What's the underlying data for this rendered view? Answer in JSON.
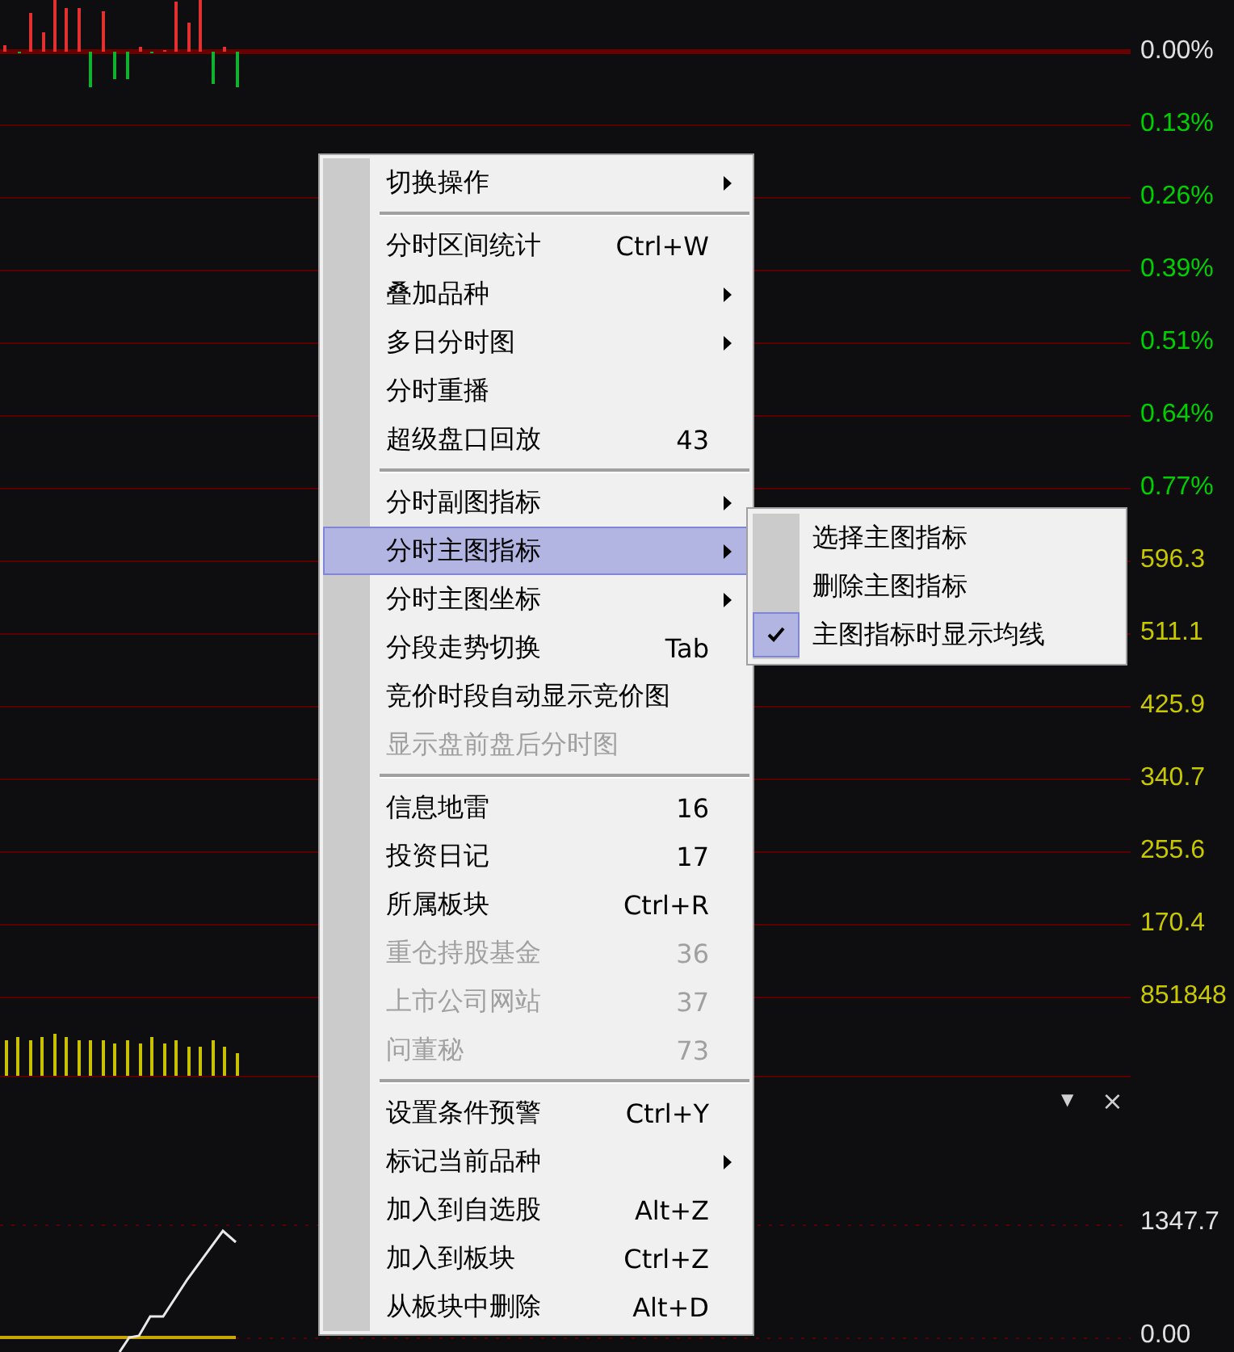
{
  "axis_labels": [
    {
      "text": "0.00%",
      "color": "#e0e0e0"
    },
    {
      "text": "0.13%",
      "color": "#00d000"
    },
    {
      "text": "0.26%",
      "color": "#00d000"
    },
    {
      "text": "0.39%",
      "color": "#00d000"
    },
    {
      "text": "0.51%",
      "color": "#00d000"
    },
    {
      "text": "0.64%",
      "color": "#00d000"
    },
    {
      "text": "0.77%",
      "color": "#00d000"
    },
    {
      "text": "596.3",
      "color": "#c8c800"
    },
    {
      "text": "511.1",
      "color": "#c8c800"
    },
    {
      "text": "425.9",
      "color": "#c8c800"
    },
    {
      "text": "340.7",
      "color": "#c8c800"
    },
    {
      "text": "255.6",
      "color": "#c8c800"
    },
    {
      "text": "170.4",
      "color": "#c8c800"
    },
    {
      "text": "851848",
      "color": "#c8c800"
    }
  ],
  "lower_panel": {
    "menu_glyph": "▼",
    "close_glyph": "×",
    "labels": [
      {
        "text": "1347.7"
      },
      {
        "text": "0.00"
      }
    ]
  },
  "menu": [
    {
      "kind": "item",
      "label": "切换操作",
      "submenu": true,
      "disabled": false,
      "selected": false
    },
    {
      "kind": "separator"
    },
    {
      "kind": "item",
      "label": "分时区间统计",
      "shortcut": "Ctrl+W",
      "submenu": false,
      "disabled": false,
      "selected": false
    },
    {
      "kind": "item",
      "label": "叠加品种",
      "submenu": true,
      "disabled": false,
      "selected": false
    },
    {
      "kind": "item",
      "label": "多日分时图",
      "submenu": true,
      "disabled": false,
      "selected": false
    },
    {
      "kind": "item",
      "label": "分时重播",
      "submenu": false,
      "disabled": false,
      "selected": false
    },
    {
      "kind": "item",
      "label": "超级盘口回放",
      "shortcut": "43",
      "submenu": false,
      "disabled": false,
      "selected": false
    },
    {
      "kind": "separator"
    },
    {
      "kind": "item",
      "label": "分时副图指标",
      "submenu": true,
      "disabled": false,
      "selected": false
    },
    {
      "kind": "item",
      "label": "分时主图指标",
      "submenu": true,
      "disabled": false,
      "selected": true
    },
    {
      "kind": "item",
      "label": "分时主图坐标",
      "submenu": true,
      "disabled": false,
      "selected": false
    },
    {
      "kind": "item",
      "label": "分段走势切换",
      "shortcut": "Tab",
      "submenu": false,
      "disabled": false,
      "selected": false
    },
    {
      "kind": "item",
      "label": "竞价时段自动显示竞价图",
      "submenu": false,
      "disabled": false,
      "selected": false
    },
    {
      "kind": "item",
      "label": "显示盘前盘后分时图",
      "submenu": false,
      "disabled": true,
      "selected": false
    },
    {
      "kind": "separator"
    },
    {
      "kind": "item",
      "label": "信息地雷",
      "shortcut": "16",
      "submenu": false,
      "disabled": false,
      "selected": false
    },
    {
      "kind": "item",
      "label": "投资日记",
      "shortcut": "17",
      "submenu": false,
      "disabled": false,
      "selected": false
    },
    {
      "kind": "item",
      "label": "所属板块",
      "shortcut": "Ctrl+R",
      "submenu": false,
      "disabled": false,
      "selected": false
    },
    {
      "kind": "item",
      "label": "重仓持股基金",
      "shortcut": "36",
      "submenu": false,
      "disabled": true,
      "selected": false
    },
    {
      "kind": "item",
      "label": "上市公司网站",
      "shortcut": "37",
      "submenu": false,
      "disabled": true,
      "selected": false
    },
    {
      "kind": "item",
      "label": "问董秘",
      "shortcut": "73",
      "submenu": false,
      "disabled": true,
      "selected": false
    },
    {
      "kind": "separator"
    },
    {
      "kind": "item",
      "label": "设置条件预警",
      "shortcut": "Ctrl+Y",
      "submenu": false,
      "disabled": false,
      "selected": false
    },
    {
      "kind": "item",
      "label": "标记当前品种",
      "submenu": true,
      "disabled": false,
      "selected": false
    },
    {
      "kind": "item",
      "label": "加入到自选股",
      "shortcut": "Alt+Z",
      "submenu": false,
      "disabled": false,
      "selected": false
    },
    {
      "kind": "item",
      "label": "加入到板块",
      "shortcut": "Ctrl+Z",
      "submenu": false,
      "disabled": false,
      "selected": false
    },
    {
      "kind": "item",
      "label": "从板块中删除",
      "shortcut": "Alt+D",
      "submenu": false,
      "disabled": false,
      "selected": false
    }
  ],
  "submenu": [
    {
      "label": "选择主图指标",
      "checked": false
    },
    {
      "label": "删除主图指标",
      "checked": false
    },
    {
      "label": "主图指标时显示均线",
      "checked": true
    }
  ]
}
